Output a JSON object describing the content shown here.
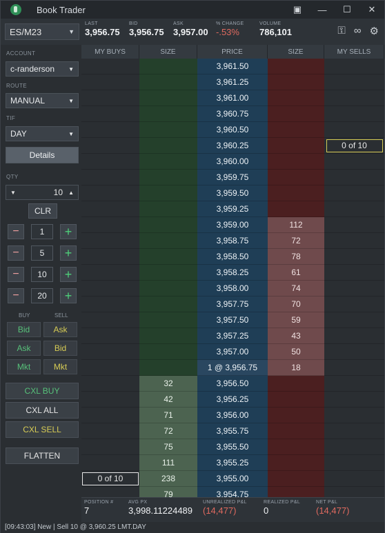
{
  "window": {
    "title": "Book Trader",
    "controls": [
      "restore-icon",
      "minimize-icon",
      "maximize-icon",
      "close-icon"
    ]
  },
  "header": {
    "symbol": "ES/M23",
    "quote": {
      "last_label": "LAST",
      "last": "3,956.75",
      "bid_label": "BID",
      "bid": "3,956.75",
      "ask_label": "ASK",
      "ask": "3,957.00",
      "change_label": "% CHANGE",
      "change": "-.53%",
      "volume_label": "VOLUME",
      "volume": "786,101"
    },
    "icons": [
      "key-icon",
      "link-icon",
      "gear-icon"
    ]
  },
  "left": {
    "account_label": "ACCOUNT",
    "account": "c-randerson",
    "route_label": "ROUTE",
    "route": "MANUAL",
    "tif_label": "TIF",
    "tif": "DAY",
    "details": "Details",
    "qty_label": "QTY",
    "qty": "10",
    "clr": "CLR",
    "steps": [
      "1",
      "5",
      "10",
      "20"
    ],
    "buy_label": "BUY",
    "sell_label": "SELL",
    "rows": [
      {
        "buy": "Bid",
        "sell": "Ask"
      },
      {
        "buy": "Ask",
        "sell": "Bid"
      },
      {
        "buy": "Mkt",
        "sell": "Mkt"
      }
    ],
    "cxl_buy": "CXL BUY",
    "cxl_all": "CXL ALL",
    "cxl_sell": "CXL SELL",
    "flatten": "FLATTEN"
  },
  "ladder": {
    "headers": {
      "my_buys": "MY BUYS",
      "bid_size": "SIZE",
      "price": "PRICE",
      "ask_size": "SIZE",
      "my_sells": "MY SELLS"
    },
    "rows": [
      {
        "price": "3,961.50",
        "bid": "",
        "ask": "",
        "mybuy": "",
        "mysell": ""
      },
      {
        "price": "3,961.25",
        "bid": "",
        "ask": "",
        "mybuy": "",
        "mysell": ""
      },
      {
        "price": "3,961.00",
        "bid": "",
        "ask": "",
        "mybuy": "",
        "mysell": ""
      },
      {
        "price": "3,960.75",
        "bid": "",
        "ask": "",
        "mybuy": "",
        "mysell": ""
      },
      {
        "price": "3,960.50",
        "bid": "",
        "ask": "",
        "mybuy": "",
        "mysell": ""
      },
      {
        "price": "3,960.25",
        "bid": "",
        "ask": "",
        "mybuy": "",
        "mysell": "0 of 10"
      },
      {
        "price": "3,960.00",
        "bid": "",
        "ask": "",
        "mybuy": "",
        "mysell": ""
      },
      {
        "price": "3,959.75",
        "bid": "",
        "ask": "",
        "mybuy": "",
        "mysell": ""
      },
      {
        "price": "3,959.50",
        "bid": "",
        "ask": "",
        "mybuy": "",
        "mysell": ""
      },
      {
        "price": "3,959.25",
        "bid": "",
        "ask": "",
        "mybuy": "",
        "mysell": ""
      },
      {
        "price": "3,959.00",
        "bid": "",
        "ask": "112",
        "mybuy": "",
        "mysell": ""
      },
      {
        "price": "3,958.75",
        "bid": "",
        "ask": "72",
        "mybuy": "",
        "mysell": ""
      },
      {
        "price": "3,958.50",
        "bid": "",
        "ask": "78",
        "mybuy": "",
        "mysell": ""
      },
      {
        "price": "3,958.25",
        "bid": "",
        "ask": "61",
        "mybuy": "",
        "mysell": ""
      },
      {
        "price": "3,958.00",
        "bid": "",
        "ask": "74",
        "mybuy": "",
        "mysell": ""
      },
      {
        "price": "3,957.75",
        "bid": "",
        "ask": "70",
        "mybuy": "",
        "mysell": ""
      },
      {
        "price": "3,957.50",
        "bid": "",
        "ask": "59",
        "mybuy": "",
        "mysell": ""
      },
      {
        "price": "3,957.25",
        "bid": "",
        "ask": "43",
        "mybuy": "",
        "mysell": ""
      },
      {
        "price": "3,957.00",
        "bid": "",
        "ask": "50",
        "mybuy": "",
        "mysell": ""
      },
      {
        "price": "1 @ 3,956.75",
        "bid": "",
        "ask": "18",
        "mybuy": "",
        "mysell": ""
      },
      {
        "price": "3,956.50",
        "bid": "32",
        "ask": "",
        "mybuy": "",
        "mysell": ""
      },
      {
        "price": "3,956.25",
        "bid": "42",
        "ask": "",
        "mybuy": "",
        "mysell": ""
      },
      {
        "price": "3,956.00",
        "bid": "71",
        "ask": "",
        "mybuy": "",
        "mysell": ""
      },
      {
        "price": "3,955.75",
        "bid": "72",
        "ask": "",
        "mybuy": "",
        "mysell": ""
      },
      {
        "price": "3,955.50",
        "bid": "75",
        "ask": "",
        "mybuy": "",
        "mysell": ""
      },
      {
        "price": "3,955.25",
        "bid": "111",
        "ask": "",
        "mybuy": "",
        "mysell": ""
      },
      {
        "price": "3,955.00",
        "bid": "238",
        "ask": "",
        "mybuy": "0 of 10",
        "mysell": ""
      },
      {
        "price": "3,954.75",
        "bid": "79",
        "ask": "",
        "mybuy": "",
        "mysell": ""
      }
    ]
  },
  "footer": {
    "position_label": "POSITION #",
    "position": "7",
    "avgpx_label": "AVG PX",
    "avgpx": "3,998.11224489",
    "unreal_label": "UNREALIZED P&L",
    "unreal": "(14,477)",
    "real_label": "REALIZED P&L",
    "real": "0",
    "net_label": "NET P&L",
    "net": "(14,477)"
  },
  "status": "[09:43:03] New | Sell 10 @ 3,960.25 LMT.DAY"
}
